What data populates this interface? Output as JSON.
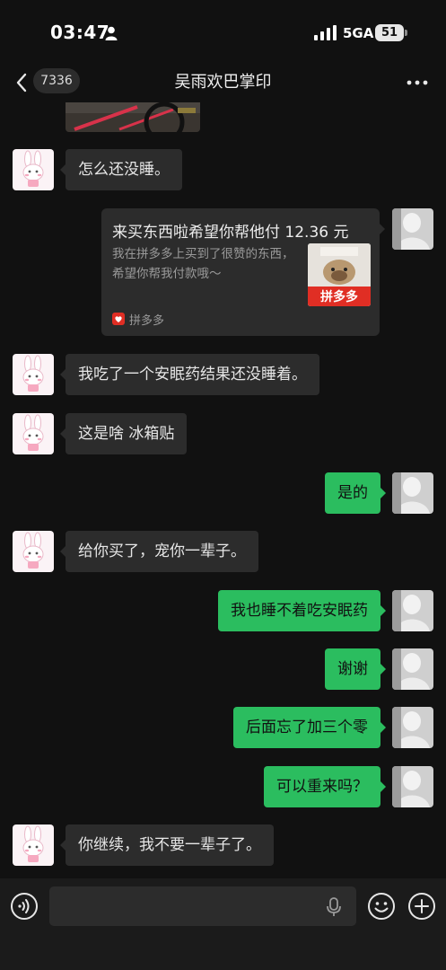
{
  "status_bar": {
    "time": "03:47",
    "network": "5GA",
    "battery": "51"
  },
  "header": {
    "back_icon": "chevron-left-icon",
    "unread_count": "7336",
    "title": "吴雨欢巴掌印",
    "more_icon": "more-dots-icon"
  },
  "messages": [
    {
      "side": "in",
      "text": "怎么还没睡。"
    },
    {
      "side": "out",
      "type": "share-card",
      "title": "来买东西啦希望你帮他付 12.36 元",
      "description": "我在拼多多上买到了很赞的东西，希望你帮我付款哦～",
      "thumb_caption": "拼多多",
      "source": "拼多多"
    },
    {
      "side": "in",
      "text": "我吃了一个安眠药结果还没睡着。"
    },
    {
      "side": "in",
      "text": "这是啥 冰箱贴"
    },
    {
      "side": "out",
      "text": "是的"
    },
    {
      "side": "in",
      "text": "给你买了，宠你一辈子。"
    },
    {
      "side": "out",
      "text": "我也睡不着吃安眠药"
    },
    {
      "side": "out",
      "text": "谢谢"
    },
    {
      "side": "out",
      "text": "后面忘了加三个零"
    },
    {
      "side": "out",
      "text": "可以重来吗？"
    },
    {
      "side": "in",
      "text": "你继续，我不要一辈子了。"
    }
  ],
  "input_bar": {
    "voice_icon": "voice-mode-icon",
    "placeholder": "",
    "mic_icon": "microphone-icon",
    "emoji_icon": "emoji-icon",
    "plus_icon": "plus-icon"
  },
  "colors": {
    "background": "#111111",
    "incoming_bubble": "#2c2c2c",
    "outgoing_bubble": "#2bbd5f",
    "brand_red": "#e02e24"
  }
}
